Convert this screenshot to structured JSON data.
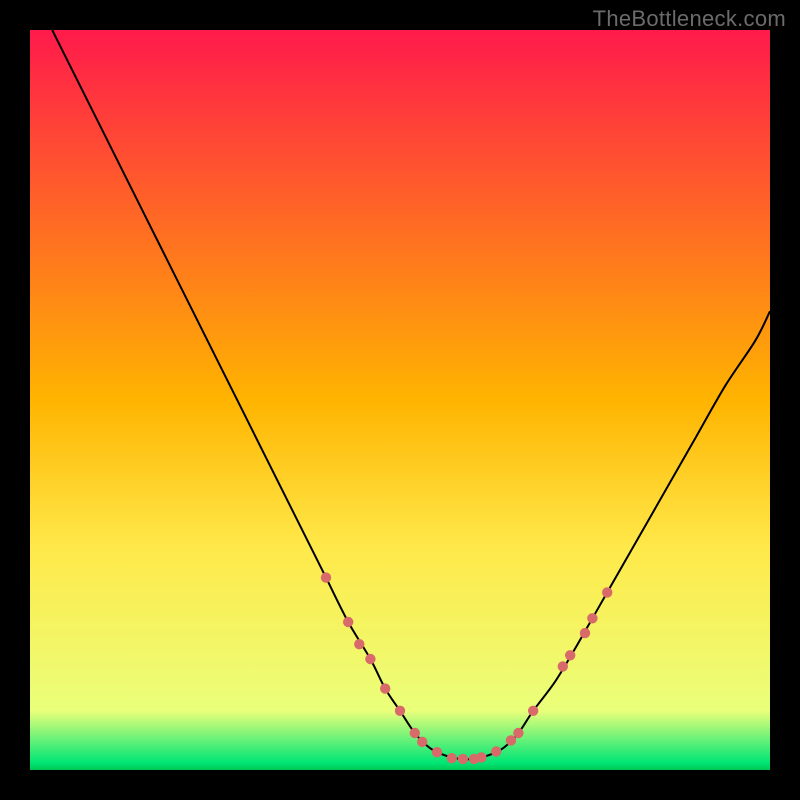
{
  "watermark": "TheBottleneck.com",
  "chart_data": {
    "type": "line",
    "title": "",
    "xlabel": "",
    "ylabel": "",
    "xlim": [
      0,
      100
    ],
    "ylim": [
      0,
      100
    ],
    "grid": false,
    "legend": false,
    "background_gradient": {
      "stops": [
        {
          "offset": 0.0,
          "color": "#ff1a4b"
        },
        {
          "offset": 0.5,
          "color": "#ffb400"
        },
        {
          "offset": 0.7,
          "color": "#ffe94a"
        },
        {
          "offset": 0.92,
          "color": "#eaff7a"
        },
        {
          "offset": 0.99,
          "color": "#00e676"
        },
        {
          "offset": 1.0,
          "color": "#00c853"
        }
      ]
    },
    "series": [
      {
        "name": "bottleneck-curve",
        "color": "#000000",
        "x": [
          3,
          6,
          10,
          14,
          18,
          22,
          26,
          30,
          34,
          37,
          40,
          43,
          46,
          48,
          50,
          52,
          54,
          56,
          58,
          60,
          62,
          64,
          66,
          68,
          71,
          74,
          78,
          82,
          86,
          90,
          94,
          98,
          100
        ],
        "y": [
          100,
          94,
          86,
          78,
          70,
          62,
          54,
          46,
          38,
          32,
          26,
          20,
          15,
          11,
          8,
          5,
          3,
          2,
          1.5,
          1.5,
          2,
          3,
          5,
          8,
          12,
          17,
          24,
          31,
          38,
          45,
          52,
          58,
          62
        ]
      }
    ],
    "markers": {
      "name": "optimum-range-dots",
      "color": "#d86a6a",
      "radius": 5.2,
      "points": [
        {
          "x": 40,
          "y": 26
        },
        {
          "x": 43,
          "y": 20
        },
        {
          "x": 44.5,
          "y": 17
        },
        {
          "x": 46,
          "y": 15
        },
        {
          "x": 48,
          "y": 11
        },
        {
          "x": 50,
          "y": 8
        },
        {
          "x": 52,
          "y": 5
        },
        {
          "x": 53,
          "y": 3.8
        },
        {
          "x": 55,
          "y": 2.4
        },
        {
          "x": 57,
          "y": 1.6
        },
        {
          "x": 58.5,
          "y": 1.5
        },
        {
          "x": 60,
          "y": 1.5
        },
        {
          "x": 61,
          "y": 1.7
        },
        {
          "x": 63,
          "y": 2.5
        },
        {
          "x": 65,
          "y": 4
        },
        {
          "x": 66,
          "y": 5
        },
        {
          "x": 68,
          "y": 8
        },
        {
          "x": 72,
          "y": 14
        },
        {
          "x": 73,
          "y": 15.5
        },
        {
          "x": 75,
          "y": 18.5
        },
        {
          "x": 76,
          "y": 20.5
        },
        {
          "x": 78,
          "y": 24
        }
      ]
    }
  }
}
